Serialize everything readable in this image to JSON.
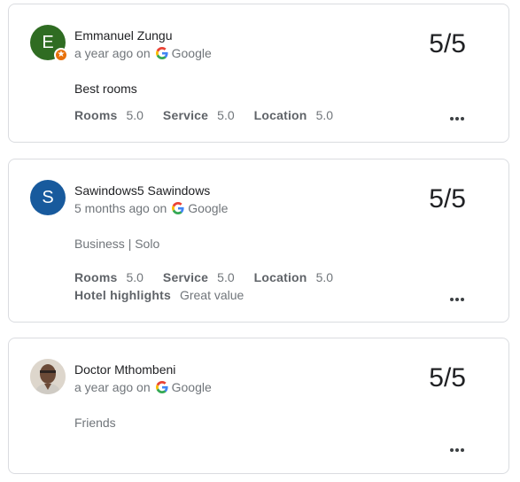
{
  "reviews": [
    {
      "avatar_letter": "E",
      "avatar_color": "#2f6c22",
      "has_badge": true,
      "name": "Emmanuel Zungu",
      "when": "a year ago on",
      "source": "Google",
      "score": "5/5",
      "text": "Best rooms",
      "ratings": [
        {
          "label": "Rooms",
          "value": "5.0"
        },
        {
          "label": "Service",
          "value": "5.0"
        },
        {
          "label": "Location",
          "value": "5.0"
        }
      ]
    },
    {
      "avatar_letter": "S",
      "avatar_color": "#185a9d",
      "name": "Sawindows5 Sawindows",
      "when": "5 months ago on",
      "source": "Google",
      "score": "5/5",
      "trip": "Business | Solo",
      "ratings": [
        {
          "label": "Rooms",
          "value": "5.0"
        },
        {
          "label": "Service",
          "value": "5.0"
        },
        {
          "label": "Location",
          "value": "5.0"
        }
      ],
      "highlights_label": "Hotel highlights",
      "highlights_value": "Great value"
    },
    {
      "avatar_icon": "person-photo-icon",
      "name": "Doctor Mthombeni",
      "when": "a year ago on",
      "source": "Google",
      "score": "5/5",
      "trip": "Friends"
    }
  ],
  "icons": {
    "source": "google-g-icon",
    "menu": "more-horizontal-icon",
    "badge": "local-guide-star-icon"
  }
}
